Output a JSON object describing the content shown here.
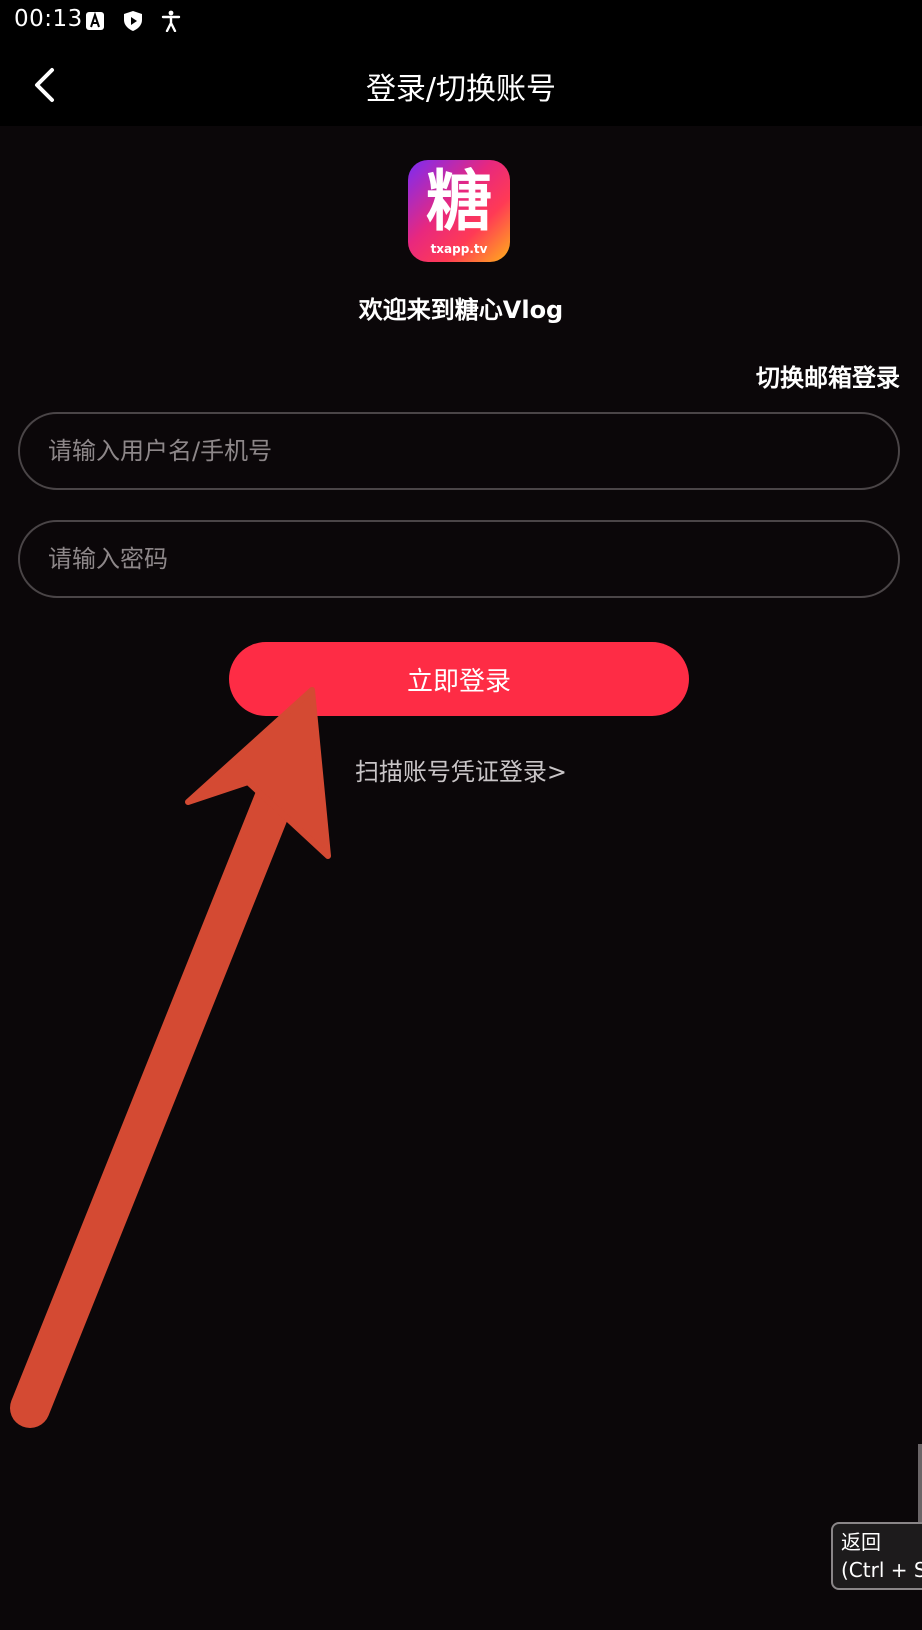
{
  "status_bar": {
    "time": "00:13",
    "icons": [
      "a-icon",
      "shield-play-icon",
      "accessibility-icon"
    ]
  },
  "app_bar": {
    "title": "登录/切换账号",
    "back_icon": "chevron-left-icon"
  },
  "logo": {
    "char": "糖",
    "sub": "txapp.tv"
  },
  "welcome_text": "欢迎来到糖心Vlog",
  "switch_email_label": "切换邮箱登录",
  "username_input": {
    "placeholder": "请输入用户名/手机号",
    "value": ""
  },
  "password_input": {
    "placeholder": "请输入密码",
    "value": ""
  },
  "login_button_label": "立即登录",
  "scan_login_label": "扫描账号凭证登录>",
  "tooltip": {
    "line1": "返回",
    "line2": "(Ctrl + Shift"
  },
  "colors": {
    "background": "#0b0709",
    "accent": "#fe2c45",
    "annotation_arrow": "#d44a33"
  }
}
